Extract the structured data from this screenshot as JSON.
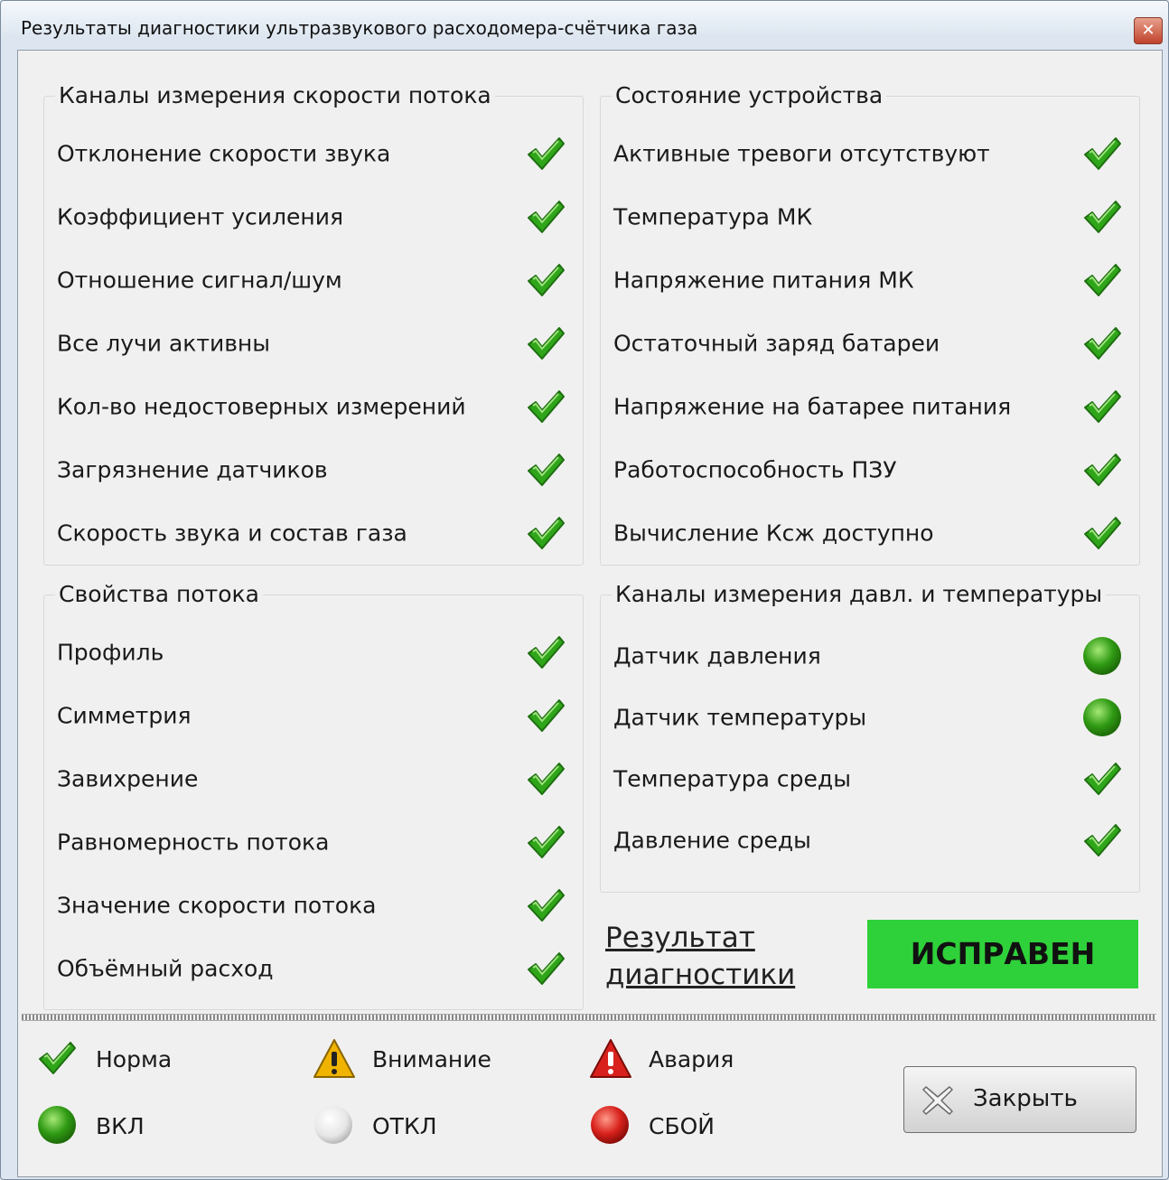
{
  "window": {
    "title": "Результаты диагностики ультразвукового расходомера-счётчика газа"
  },
  "groups": {
    "flow_channels": {
      "title": "Каналы измерения скорости потока",
      "items": [
        {
          "label": "Отклонение скорости звука",
          "status": "check"
        },
        {
          "label": "Коэффициент усиления",
          "status": "check"
        },
        {
          "label": "Отношение сигнал/шум",
          "status": "check"
        },
        {
          "label": "Все лучи активны",
          "status": "check"
        },
        {
          "label": "Кол-во недостоверных измерений",
          "status": "check"
        },
        {
          "label": "Загрязнение датчиков",
          "status": "check"
        },
        {
          "label": "Скорость звука и состав газа",
          "status": "check"
        }
      ]
    },
    "device_state": {
      "title": "Состояние устройства",
      "items": [
        {
          "label": "Активные тревоги отсутствуют",
          "status": "check"
        },
        {
          "label": "Температура МК",
          "status": "check"
        },
        {
          "label": "Напряжение питания МК",
          "status": "check"
        },
        {
          "label": "Остаточный заряд батареи",
          "status": "check"
        },
        {
          "label": "Напряжение на батарее питания",
          "status": "check"
        },
        {
          "label": "Работоспособность ПЗУ",
          "status": "check"
        },
        {
          "label": "Вычисление Ксж доступно",
          "status": "check"
        }
      ]
    },
    "flow_props": {
      "title": "Свойства потока",
      "items": [
        {
          "label": "Профиль",
          "status": "check"
        },
        {
          "label": "Симметрия",
          "status": "check"
        },
        {
          "label": "Завихрение",
          "status": "check"
        },
        {
          "label": "Равномерность потока",
          "status": "check"
        },
        {
          "label": "Значение скорости потока",
          "status": "check"
        },
        {
          "label": "Объёмный расход",
          "status": "check"
        }
      ]
    },
    "pt_channels": {
      "title": "Каналы измерения давл. и температуры",
      "items": [
        {
          "label": "Датчик давления",
          "status": "on"
        },
        {
          "label": "Датчик температуры",
          "status": "on"
        },
        {
          "label": "Температура среды",
          "status": "check"
        },
        {
          "label": "Давление среды",
          "status": "check"
        }
      ]
    }
  },
  "result": {
    "label_line1": "Результат",
    "label_line2": "диагностики",
    "status": "ИСПРАВЕН",
    "status_color": "#2fd13a"
  },
  "legend": {
    "norm": "Норма",
    "warning": "Внимание",
    "alarm": "Авария",
    "on": "ВКЛ",
    "off": "ОТКЛ",
    "fault": "СБОЙ"
  },
  "buttons": {
    "close": "Закрыть"
  },
  "colors": {
    "check": "#2fa51a",
    "on": "#2f9a13",
    "warning": "#f0b400",
    "alarm": "#d8211c",
    "fault": "#d8211c"
  }
}
